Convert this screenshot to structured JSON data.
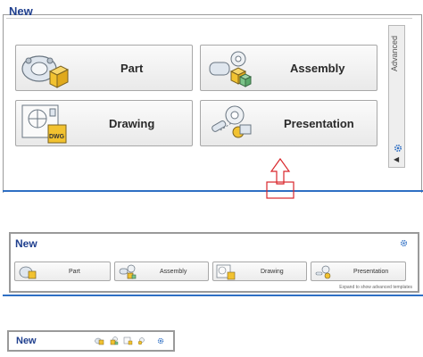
{
  "panel_large": {
    "title": "New",
    "templates": [
      {
        "label": "Part",
        "icon": "part-icon"
      },
      {
        "label": "Assembly",
        "icon": "assembly-icon"
      },
      {
        "label": "Drawing",
        "icon": "drawing-icon"
      },
      {
        "label": "Presentation",
        "icon": "presentation-icon"
      }
    ],
    "advanced_tab": "Advanced",
    "drawing_badge": "DWG"
  },
  "panel_medium": {
    "title": "New",
    "templates": [
      {
        "label": "Part"
      },
      {
        "label": "Assembly"
      },
      {
        "label": "Drawing"
      },
      {
        "label": "Presentation"
      }
    ],
    "hint": "Expand to show advanced templates"
  },
  "panel_compact": {
    "title": "New"
  },
  "colors": {
    "title": "#1f3f8e",
    "accent_line": "#2e6fc4",
    "callout": "#d9262b",
    "cube_yellow": "#f2c230"
  }
}
